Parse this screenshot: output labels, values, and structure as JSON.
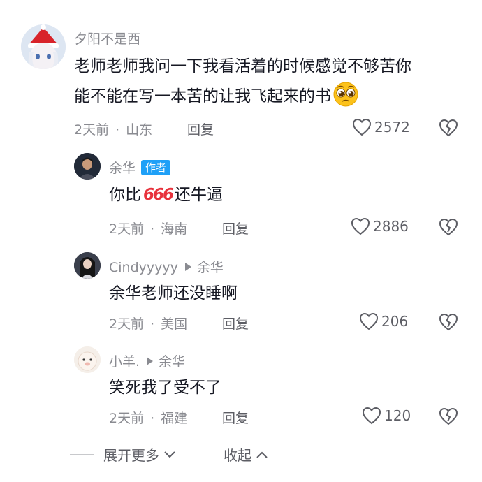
{
  "comments": [
    {
      "username": "夕阳不是西",
      "text_line1": "老师老师我问一下我看活着的时候感觉不够苦你",
      "text_line2": "能不能在写一本苦的让我飞起来的书",
      "time": "2天前",
      "location": "山东",
      "reply_label": "回复",
      "likes": "2572",
      "emoji": "pleading-face-emoji"
    }
  ],
  "replies": [
    {
      "username": "余华",
      "author_badge": "作者",
      "text_pre": "你比",
      "text_mid": "666",
      "text_post": "还牛逼",
      "time": "2天前",
      "location": "海南",
      "reply_label": "回复",
      "likes": "2886"
    },
    {
      "username": "Cindyyyyy",
      "reply_to": "余华",
      "text": "余华老师还没睡啊",
      "time": "2天前",
      "location": "美国",
      "reply_label": "回复",
      "likes": "206"
    },
    {
      "username": "小羊.",
      "reply_to": "余华",
      "text": "笑死我了受不了",
      "time": "2天前",
      "location": "福建",
      "reply_label": "回复",
      "likes": "120"
    }
  ],
  "footer": {
    "expand_label": "展开更多",
    "collapse_label": "收起"
  },
  "colors": {
    "text": "#161823",
    "secondary": "#8a8b91",
    "badge": "#1fa0f7",
    "red_666": "#e8323c"
  },
  "icons": [
    "heart-outline-icon",
    "broken-heart-icon",
    "chevron-down-icon",
    "chevron-up-icon",
    "reply-arrow-icon"
  ]
}
